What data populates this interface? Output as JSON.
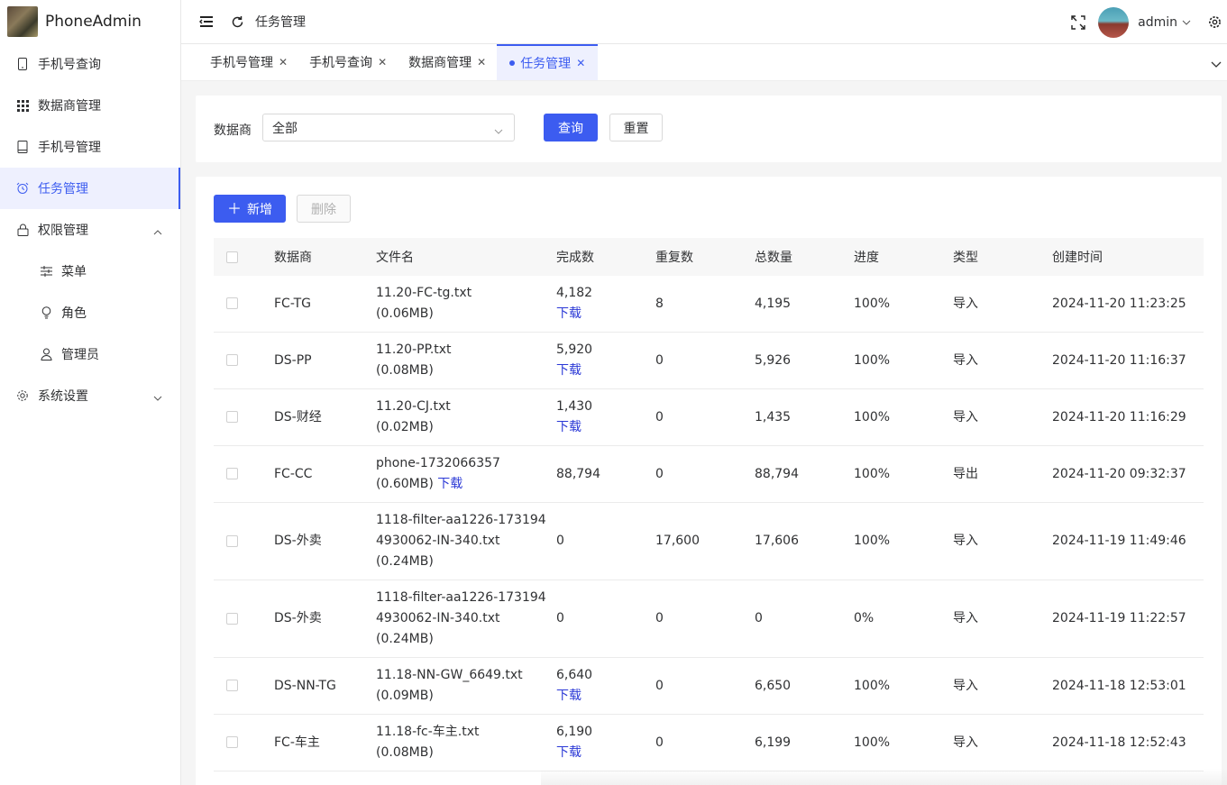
{
  "app": {
    "name": "PhoneAdmin"
  },
  "sidebar": {
    "items": [
      {
        "label": "手机号查询",
        "icon": "phone-icon"
      },
      {
        "label": "数据商管理",
        "icon": "grid-icon"
      },
      {
        "label": "手机号管理",
        "icon": "book-icon"
      },
      {
        "label": "任务管理",
        "icon": "alarm-clock-icon",
        "active": true
      },
      {
        "label": "权限管理",
        "icon": "lock-icon",
        "expanded": true
      },
      {
        "label": "菜单",
        "icon": "sliders-icon"
      },
      {
        "label": "角色",
        "icon": "bulb-icon"
      },
      {
        "label": "管理员",
        "icon": "user-icon"
      },
      {
        "label": "系统设置",
        "icon": "gear-icon",
        "expanded": false
      }
    ]
  },
  "header": {
    "title": "任务管理",
    "username": "admin"
  },
  "tabs": [
    {
      "label": "手机号管理"
    },
    {
      "label": "手机号查询"
    },
    {
      "label": "数据商管理"
    },
    {
      "label": "任务管理",
      "active": true
    }
  ],
  "filter": {
    "label": "数据商",
    "select_value": "全部",
    "query_label": "查询",
    "reset_label": "重置"
  },
  "toolbar": {
    "add_label": "新增",
    "delete_label": "删除"
  },
  "table": {
    "columns": [
      "数据商",
      "文件名",
      "完成数",
      "重复数",
      "总数量",
      "进度",
      "类型",
      "创建时间"
    ],
    "download_label": "下载",
    "rows": [
      {
        "provider": "FC-TG",
        "file": "11.20-FC-tg.txt",
        "size": "(0.06MB)",
        "done": "4,182",
        "dup": "8",
        "total": "4,195",
        "progress": "100%",
        "type": "导入",
        "created": "2024-11-20 11:23:25"
      },
      {
        "provider": "DS-PP",
        "file": "11.20-PP.txt",
        "size": "(0.08MB)",
        "done": "5,920",
        "dup": "0",
        "total": "5,926",
        "progress": "100%",
        "type": "导入",
        "created": "2024-11-20 11:16:37"
      },
      {
        "provider": "DS-财经",
        "file": "11.20-CJ.txt",
        "size": "(0.02MB)",
        "done": "1,430",
        "dup": "0",
        "total": "1,435",
        "progress": "100%",
        "type": "导入",
        "created": "2024-11-20 11:16:29"
      },
      {
        "provider": "FC-CC",
        "file": "phone-1732066357",
        "size": "(0.60MB)",
        "done": "88,794",
        "dup": "0",
        "total": "88,794",
        "progress": "100%",
        "type": "导出",
        "created": "2024-11-20 09:32:37"
      },
      {
        "provider": "DS-外卖",
        "file_line1": "1118-filter-aa1226-173194",
        "file_line2": "4930062-IN-340.txt",
        "size": "(0.24MB)",
        "done": "0",
        "dup": "17,600",
        "total": "17,606",
        "progress": "100%",
        "type": "导入",
        "created": "2024-11-19 11:49:46"
      },
      {
        "provider": "DS-外卖",
        "file_line1": "1118-filter-aa1226-173194",
        "file_line2": "4930062-IN-340.txt",
        "size": "(0.24MB)",
        "done": "0",
        "dup": "0",
        "total": "0",
        "progress": "0%",
        "type": "导入",
        "created": "2024-11-19 11:22:57"
      },
      {
        "provider": "DS-NN-TG",
        "file": "11.18-NN-GW_6649.txt",
        "size": "(0.09MB)",
        "done": "6,640",
        "dup": "0",
        "total": "6,650",
        "progress": "100%",
        "type": "导入",
        "created": "2024-11-18 12:53:01"
      },
      {
        "provider": "FC-车主",
        "file": "11.18-fc-车主.txt",
        "size": "(0.08MB)",
        "done": "6,190",
        "dup": "0",
        "total": "6,199",
        "progress": "100%",
        "type": "导入",
        "created": "2024-11-18 12:52:43"
      }
    ]
  },
  "colors": {
    "accent": "#3c5cf0",
    "link": "#2a38d6"
  }
}
